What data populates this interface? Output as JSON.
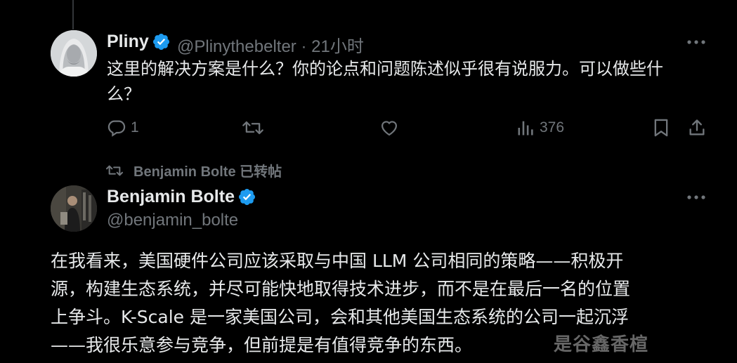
{
  "reply": {
    "author_name": "Pliny",
    "author_handle": "@Plinythebelter",
    "separator": "·",
    "time": "21小时",
    "text_line1": "这里的解决方案是什么？你的论点和问题陈述似乎很有说服力。可以做些什",
    "text_line2": "么？",
    "replies_count": "1",
    "views_count": "376",
    "icons": [
      "reply-icon",
      "retweet-icon",
      "like-icon",
      "views-icon",
      "bookmark-icon",
      "share-icon",
      "more-icon",
      "verified-icon"
    ]
  },
  "retweet_note": {
    "text": "Benjamin Bolte 已转帖",
    "icon": "retweet-icon"
  },
  "main_tweet": {
    "author_name": "Benjamin Bolte",
    "author_handle": "@benjamin_bolte",
    "lines": [
      "在我看来，美国硬件公司应该采取与中国 LLM 公司相同的策略——积极开",
      "源，构建生态系统，并尽可能快地取得技术进步，而不是在最后一名的位置",
      "上争斗。K-Scale 是一家美国公司，会和其他美国生态系统的公司一起沉浮",
      "——我很乐意参与竞争，但前提是有值得竞争的东西。"
    ]
  },
  "watermark": "是谷鑫香楦",
  "colors": {
    "background": "#000000",
    "text_primary": "#e7e9ea",
    "text_secondary": "#71767b",
    "verified_blue": "#1d9bf0",
    "thread_line": "#333639"
  }
}
